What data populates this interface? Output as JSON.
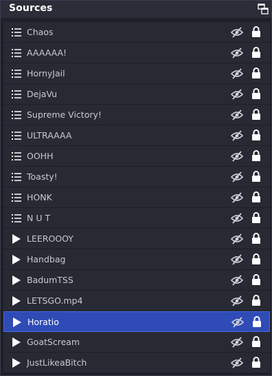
{
  "panel": {
    "title": "Sources",
    "header_icon": "undock-icon"
  },
  "colors": {
    "background": "#1e1f29",
    "row": "#272a33",
    "header": "#2b2e38",
    "selected": "#2f4bb5",
    "text": "#c8cad2"
  },
  "sources": [
    {
      "label": "Chaos",
      "type": "scene",
      "icon": "list-icon",
      "selected": false
    },
    {
      "label": "AAAAAA!",
      "type": "scene",
      "icon": "list-icon",
      "selected": false
    },
    {
      "label": "HornyJail",
      "type": "scene",
      "icon": "list-icon",
      "selected": false
    },
    {
      "label": "DejaVu",
      "type": "scene",
      "icon": "list-icon",
      "selected": false
    },
    {
      "label": "Supreme Victory!",
      "type": "scene",
      "icon": "list-icon",
      "selected": false
    },
    {
      "label": "ULTRAAAA",
      "type": "scene",
      "icon": "list-icon",
      "selected": false
    },
    {
      "label": "OOHH",
      "type": "scene",
      "icon": "list-icon",
      "selected": false
    },
    {
      "label": "Toasty!",
      "type": "scene",
      "icon": "list-icon",
      "selected": false
    },
    {
      "label": "HONK",
      "type": "scene",
      "icon": "list-icon",
      "selected": false
    },
    {
      "label": "N U T",
      "type": "scene",
      "icon": "list-icon",
      "selected": false
    },
    {
      "label": "LEEROOOY",
      "type": "media",
      "icon": "play-icon",
      "selected": false
    },
    {
      "label": "Handbag",
      "type": "media",
      "icon": "play-icon",
      "selected": false
    },
    {
      "label": "BadumTSS",
      "type": "media",
      "icon": "play-icon",
      "selected": false
    },
    {
      "label": "LETSGO.mp4",
      "type": "media",
      "icon": "play-icon",
      "selected": false
    },
    {
      "label": "Horatio",
      "type": "media",
      "icon": "play-icon",
      "selected": true
    },
    {
      "label": "GoatScream",
      "type": "media",
      "icon": "play-icon",
      "selected": false
    },
    {
      "label": "JustLikeaBitch",
      "type": "media",
      "icon": "play-icon",
      "selected": false
    }
  ]
}
